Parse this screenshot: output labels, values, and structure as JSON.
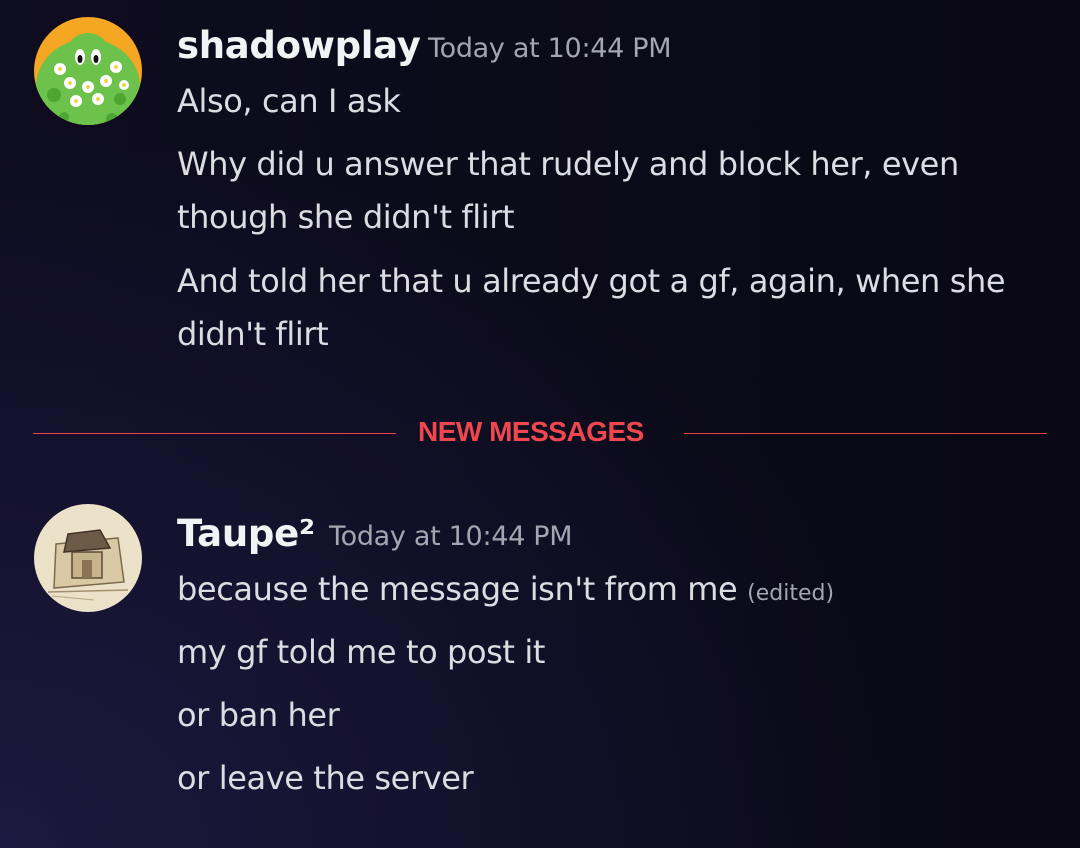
{
  "messages_top": {
    "username": "shadowplay",
    "timestamp": "Today at 10:44 PM",
    "avatar_icon": "green-flower-character-avatar",
    "lines": [
      "Also, can I ask",
      "Why did u answer that rudely and block her, even though she didn't flirt",
      "And told her that u already got a gf, again, when she didn't flirt"
    ]
  },
  "divider": {
    "label": "NEW MESSAGES",
    "color": "#f0474f"
  },
  "messages_bottom": {
    "username": "Taupe²",
    "timestamp": "Today at 10:44 PM",
    "avatar_icon": "sketch-house-avatar",
    "lines": [
      "because the message isn't from me",
      "my gf told me to post it",
      "or ban her",
      "or leave the server"
    ],
    "edited_label": "(edited)"
  }
}
